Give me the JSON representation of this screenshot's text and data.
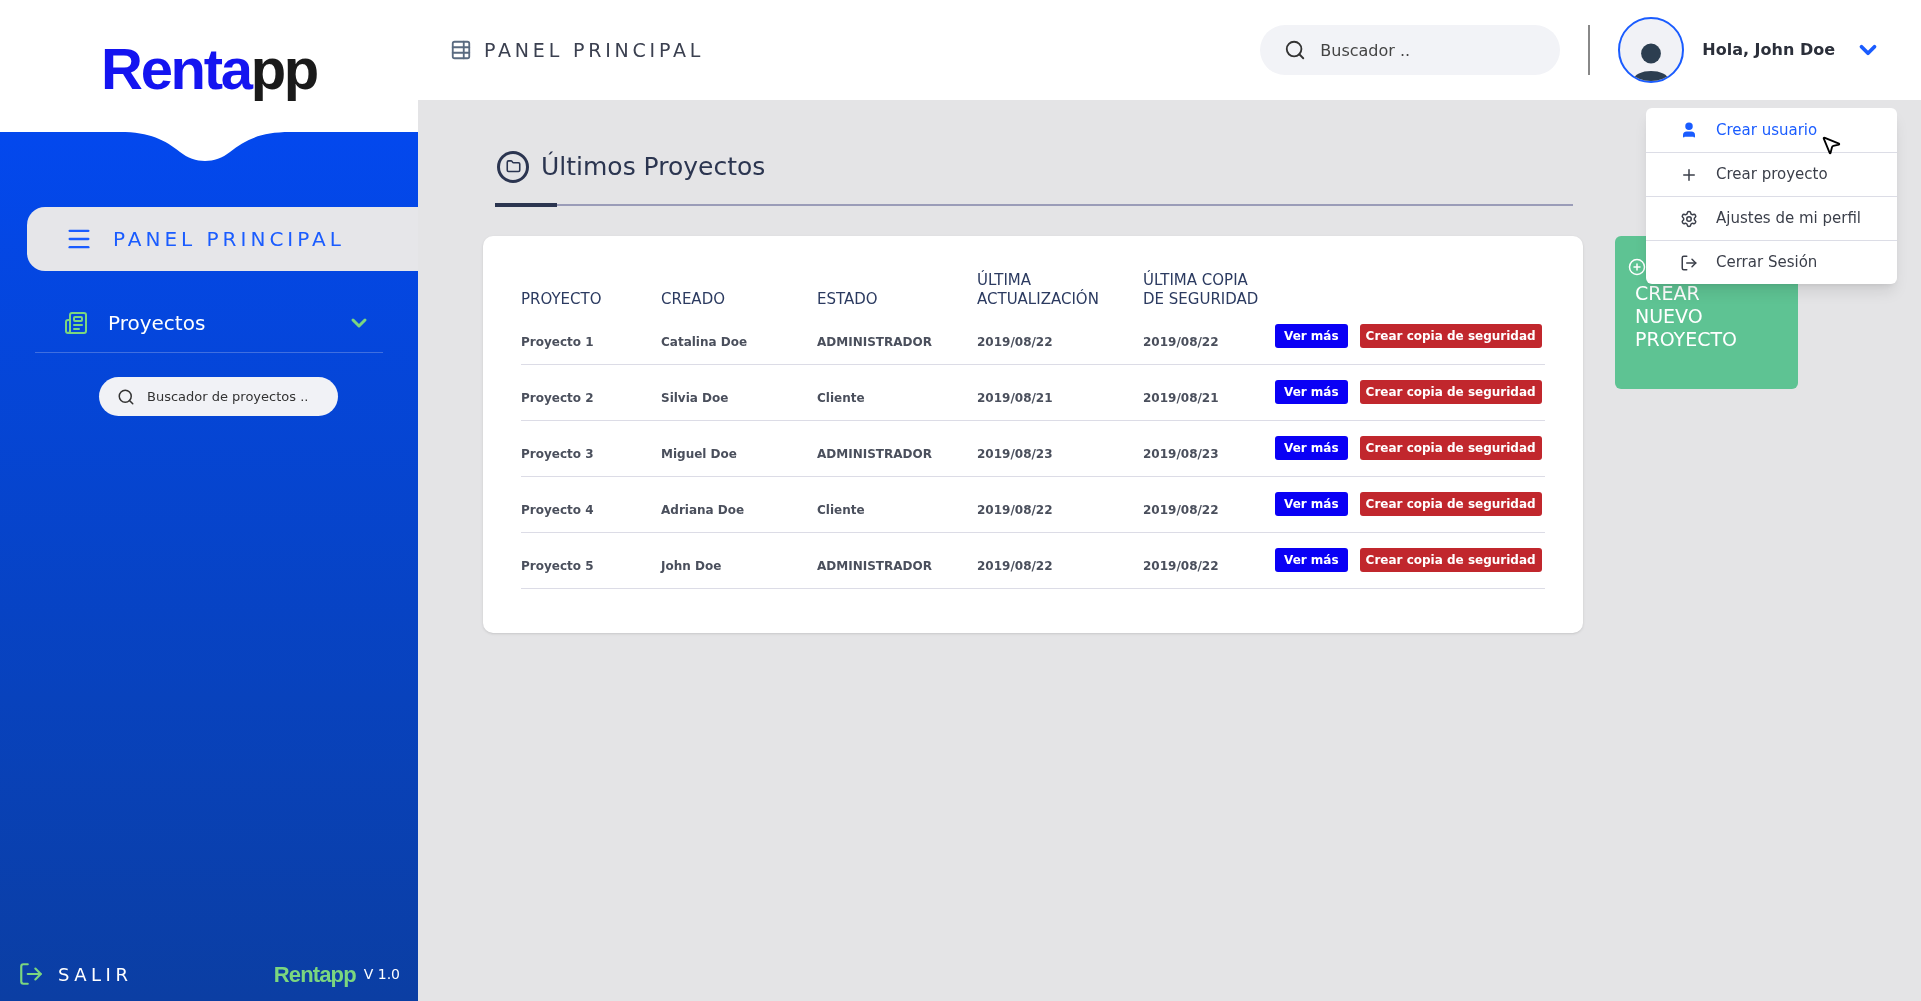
{
  "logo": {
    "primary": "Renta",
    "secondary": "pp"
  },
  "sidebar": {
    "items": [
      {
        "label": "PANEL PRINCIPAL",
        "kind": "menu",
        "selected": true
      },
      {
        "label": "Proyectos",
        "kind": "section",
        "selected": false
      }
    ],
    "search": {
      "placeholder": "Buscador de proyectos .."
    },
    "exit": "SALIR",
    "footer_logo": "Rentapp",
    "version": "V 1.0"
  },
  "header": {
    "title": "PANEL PRINCIPAL",
    "search": {
      "placeholder": "Buscador .."
    },
    "greeting": "Hola, John Doe"
  },
  "section_title": "Últimos Proyectos",
  "table": {
    "columns": [
      "PROYECTO",
      "CREADO",
      "ESTADO",
      "ÚLTIMA ACTUALIZACIÓN",
      "ÚLTIMA COPIA DE SEGURIDAD"
    ],
    "rows": [
      {
        "cells": [
          "Proyecto 1",
          "Catalina Doe",
          "ADMINISTRADOR",
          "2019/08/22",
          "2019/08/22"
        ],
        "actions": [
          "Ver más",
          "Crear copia de seguridad"
        ]
      },
      {
        "cells": [
          "Proyecto 2",
          "Silvia Doe",
          "Cliente",
          "2019/08/21",
          "2019/08/21"
        ],
        "actions": [
          "Ver más",
          "Crear copia de seguridad"
        ]
      },
      {
        "cells": [
          "Proyecto 3",
          "Miguel Doe",
          "ADMINISTRADOR",
          "2019/08/23",
          "2019/08/23"
        ],
        "actions": [
          "Ver más",
          "Crear copia de seguridad"
        ]
      },
      {
        "cells": [
          "Proyecto 4",
          "Adriana Doe",
          "Cliente",
          "2019/08/22",
          "2019/08/22"
        ],
        "actions": [
          "Ver más",
          "Crear copia de seguridad"
        ]
      },
      {
        "cells": [
          "Proyecto 5",
          "John Doe",
          "ADMINISTRADOR",
          "2019/08/22",
          "2019/08/22"
        ],
        "actions": [
          "Ver más",
          "Crear copia de seguridad"
        ]
      }
    ]
  },
  "create_card": {
    "label": "CREAR NUEVO PROYECTO"
  },
  "user_menu": {
    "items": [
      {
        "label": "Crear usuario",
        "kind": "user",
        "selected": true
      },
      {
        "label": "Crear proyecto",
        "kind": "plus",
        "selected": false
      },
      {
        "label": "Ajustes de mi perfil",
        "kind": "settings",
        "selected": false
      },
      {
        "label": "Cerrar Sesión",
        "kind": "logout",
        "selected": false
      }
    ]
  }
}
